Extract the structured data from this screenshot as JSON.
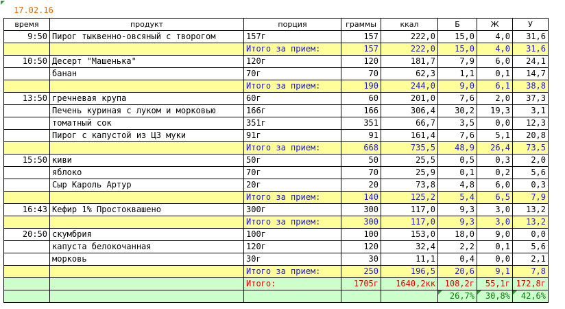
{
  "sheet": {
    "date": "17.02.16"
  },
  "headers": {
    "time": "время",
    "product": "продукт",
    "portion": "порция",
    "grams": "граммы",
    "kcal": "ккал",
    "b": "Б",
    "zh": "Ж",
    "u": "У"
  },
  "meals": [
    {
      "time": "9:50",
      "items": [
        {
          "product": "Пирог тыквенно-овсяный с творогом",
          "portion": "157г",
          "grams": "157",
          "kcal": "222,0",
          "b": "15,0",
          "zh": "4,0",
          "u": "31,6"
        }
      ],
      "subtotal": {
        "label": "Итого за прием:",
        "grams": "157",
        "kcal": "222,0",
        "b": "15,0",
        "zh": "4,0",
        "u": "31,6"
      }
    },
    {
      "time": "10:50",
      "items": [
        {
          "product": "Десерт \"Машенька\"",
          "portion": "120г",
          "grams": "120",
          "kcal": "181,7",
          "b": "7,9",
          "zh": "6,0",
          "u": "24,1"
        },
        {
          "product": "банан",
          "portion": "70г",
          "grams": "70",
          "kcal": "62,3",
          "b": "1,1",
          "zh": "0,1",
          "u": "14,7"
        }
      ],
      "subtotal": {
        "label": "Итого за прием:",
        "grams": "190",
        "kcal": "244,0",
        "b": "9,0",
        "zh": "6,1",
        "u": "38,8"
      }
    },
    {
      "time": "13:50",
      "items": [
        {
          "product": "гречневая крупа",
          "portion": "60г",
          "grams": "60",
          "kcal": "201,0",
          "b": "7,6",
          "zh": "2,0",
          "u": "37,3"
        },
        {
          "product": "Печень куриная с луком и морковью",
          "portion": "166г",
          "grams": "166",
          "kcal": "306,4",
          "b": "30,2",
          "zh": "19,3",
          "u": "3,1"
        },
        {
          "product": "томатный сок",
          "portion": "351г",
          "grams": "351",
          "kcal": "66,7",
          "b": "3,5",
          "zh": "0,0",
          "u": "12,3"
        },
        {
          "product": "Пирог с капустой из ЦЗ муки",
          "portion": "91г",
          "grams": "91",
          "kcal": "161,4",
          "b": "7,6",
          "zh": "5,1",
          "u": "20,8"
        }
      ],
      "subtotal": {
        "label": "Итого за прием:",
        "grams": "668",
        "kcal": "735,5",
        "b": "48,9",
        "zh": "26,4",
        "u": "73,5"
      }
    },
    {
      "time": "15:50",
      "items": [
        {
          "product": "киви",
          "portion": "50г",
          "grams": "50",
          "kcal": "25,5",
          "b": "0,5",
          "zh": "0,3",
          "u": "2,0"
        },
        {
          "product": "яблоко",
          "portion": "70г",
          "grams": "70",
          "kcal": "25,9",
          "b": "0,1",
          "zh": "0,2",
          "u": "5,6"
        },
        {
          "product": "Сыр Кароль Артур",
          "portion": "20г",
          "grams": "20",
          "kcal": "73,8",
          "b": "4,8",
          "zh": "6,0",
          "u": "0,3"
        }
      ],
      "subtotal": {
        "label": "Итого за прием:",
        "grams": "140",
        "kcal": "125,2",
        "b": "5,4",
        "zh": "6,5",
        "u": "7,9"
      }
    },
    {
      "time": "16:43",
      "items": [
        {
          "product": "Кефир 1% Простоквашено",
          "portion": "300г",
          "grams": "300",
          "kcal": "117,0",
          "b": "9,3",
          "zh": "3,0",
          "u": "13,2"
        }
      ],
      "subtotal": {
        "label": "Итого за прием:",
        "grams": "300",
        "kcal": "117,0",
        "b": "9,3",
        "zh": "3,0",
        "u": "13,2"
      }
    },
    {
      "time": "20:50",
      "items": [
        {
          "product": "скумбрия",
          "portion": "100г",
          "grams": "100",
          "kcal": "153,0",
          "b": "18,0",
          "zh": "9,0",
          "u": "0,0"
        },
        {
          "product": "капуста белокочанная",
          "portion": "120г",
          "grams": "120",
          "kcal": "32,4",
          "b": "2,2",
          "zh": "0,1",
          "u": "5,6"
        },
        {
          "product": "морковь",
          "portion": "30г",
          "grams": "30",
          "kcal": "11,1",
          "b": "0,4",
          "zh": "0,0",
          "u": "2,1"
        }
      ],
      "subtotal": {
        "label": "Итого за прием:",
        "grams": "250",
        "kcal": "196,5",
        "b": "20,6",
        "zh": "9,1",
        "u": "7,8"
      }
    }
  ],
  "total": {
    "label": "Итого:",
    "grams": "1705г",
    "kcal": "1640,2кк",
    "b": "108,2г",
    "zh": "55,1г",
    "u": "172,8г"
  },
  "percent": {
    "b": "26,7%",
    "zh": "30,8%",
    "u": "42,6%"
  },
  "colors": {
    "subtotal_bg": "#ffff99",
    "subtotal_text": "#1a1ad2",
    "total_bg": "#ccffcc",
    "total_text": "#e00000",
    "percent_text": "#0a7a0a",
    "date_text": "#e06c00"
  }
}
